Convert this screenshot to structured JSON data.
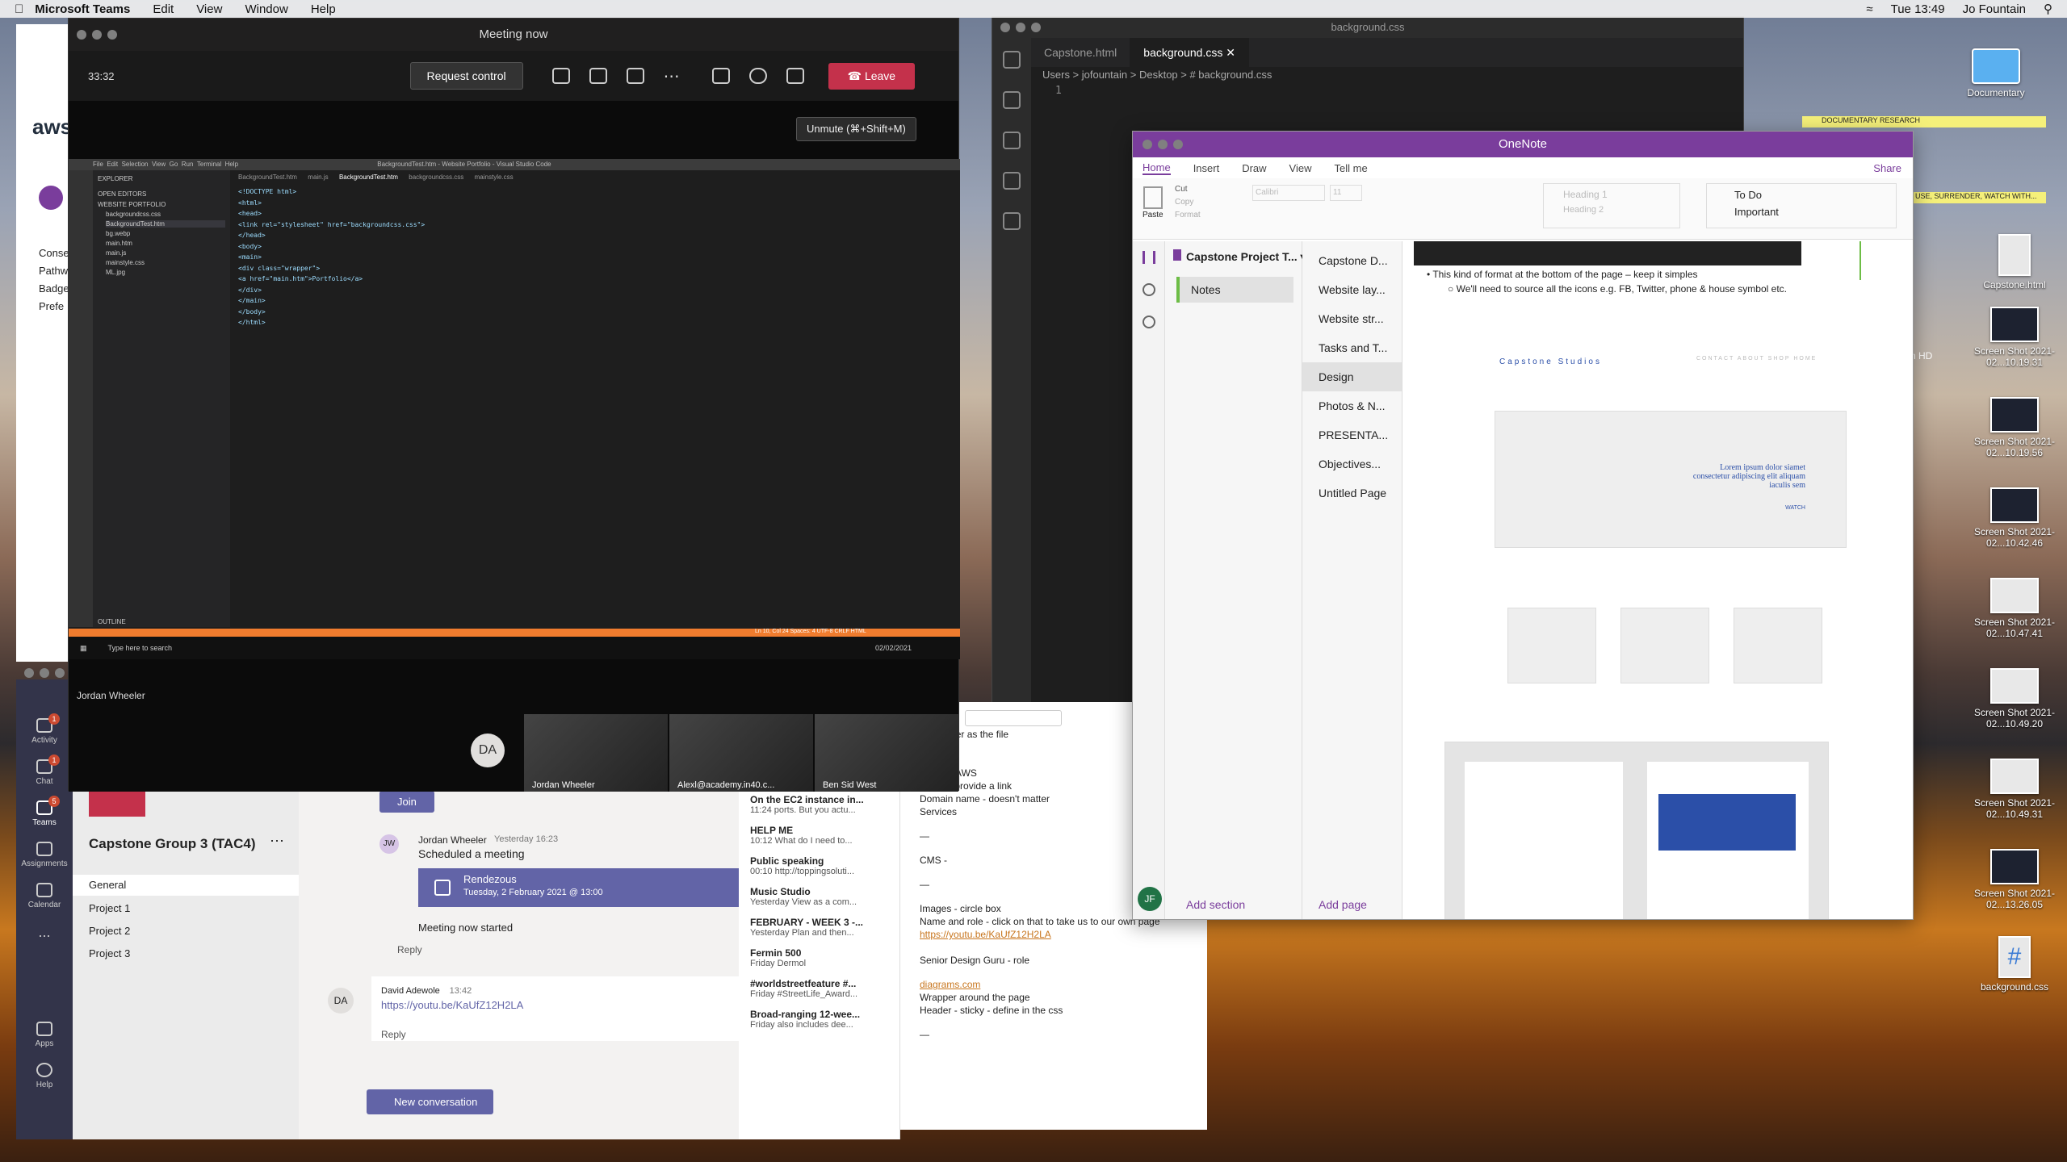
{
  "menubar": {
    "app": "Microsoft Teams",
    "menus": [
      "Edit",
      "View",
      "Window",
      "Help"
    ],
    "clock": "Tue 13:49",
    "user": "Jo Fountain"
  },
  "desktop": {
    "icons": [
      {
        "label": "Documentary"
      },
      {
        "label": "Capstone.html"
      },
      {
        "label": "Screen Shot 2021-02...10.19.31"
      },
      {
        "label": "Screen Shot 2021-02...10.19.56"
      },
      {
        "label": "Screen Shot 2021-02...10.42.46"
      },
      {
        "label": "Screen Shot 2021-02...10.47.41"
      },
      {
        "label": "Screen Shot 2021-02...10.49.20"
      },
      {
        "label": "Screen Shot 2021-02...10.49.31"
      },
      {
        "label": "Screen Shot 2021-02...13.26.05"
      },
      {
        "label": "background.css"
      }
    ],
    "partial_label": "sh HD",
    "sticky": [
      "DOCUMENTARY RESEARCH",
      "USE, SURRENDER, WATCH WITH..."
    ]
  },
  "vscode": {
    "title": "background.css",
    "tabs": [
      "Capstone.html",
      "background.css"
    ],
    "breadcrumb": "Users > jofountain > Desktop > # background.css",
    "line": "1"
  },
  "meeting": {
    "title": "Meeting now",
    "timer": "33:32",
    "request": "Request control",
    "leave": "Leave",
    "tooltip": "Unmute (⌘+Shift+M)",
    "presenter": "Jordan Wheeler",
    "participants": [
      "DA",
      "Jordan Wheeler",
      "Alexl@academy.in40.c...",
      "Ben Sid West"
    ],
    "shared": {
      "window_title": "BackgroundTest.htm - Website Portfolio - Visual Studio Code",
      "menu": [
        "File",
        "Edit",
        "Selection",
        "View",
        "Go",
        "Run",
        "Terminal",
        "Help"
      ],
      "tabs": [
        "BackgroundTest.htm",
        "main.js",
        "BackgroundTest.htm",
        "backgroundcss.css",
        "mainstyle.css"
      ],
      "explorer_title": "EXPLORER",
      "open_editors": "OPEN EDITORS",
      "folder": "WEBSITE PORTFOLIO",
      "files": [
        "backgroundcss.css",
        "BackgroundTest.htm",
        "bg.webp",
        "main.htm",
        "main.js",
        "mainstyle.css",
        "ML.jpg"
      ],
      "outline": "OUTLINE",
      "code": [
        "<!DOCTYPE html>",
        "<html>",
        "<head>",
        "    <link rel=\"stylesheet\" href=\"backgroundcss.css\">",
        "</head>",
        "",
        "<body>",
        "    <main>",
        "        <div class=\"wrapper\">",
        "            <a href=\"main.htm\">Portfolio</a>",
        "        </div>",
        "    </main>",
        "",
        "</body>",
        "",
        "</html>"
      ],
      "status": "Ln 10, Col 24   Spaces: 4   UTF-8   CRLF   HTML",
      "search": "Type here to search",
      "time": "13:49",
      "date": "02/02/2021"
    }
  },
  "teams": {
    "rail": [
      "Activity",
      "Chat",
      "Teams",
      "Assignments",
      "Calendar",
      "...",
      "Apps",
      "Help"
    ],
    "team_name": "Capstone Group 3 (TAC4)",
    "channels": [
      "General",
      "Project 1",
      "Project 2",
      "Project 3"
    ],
    "join": "Join",
    "post1_author": "Jordan Wheeler",
    "post1_time": "Yesterday 16:23",
    "post1_text": "Scheduled a meeting",
    "meeting_card_title": "Rendezous",
    "meeting_card_time": "Tuesday, 2 February 2021 @ 13:00",
    "meeting_started": "Meeting now started",
    "reply": "Reply",
    "post2_author": "David Adewole",
    "post2_time": "13:42",
    "post2_link": "https://youtu.be/KaUfZ12H2LA",
    "new_conversation": "New conversation",
    "avatar_jw": "JW",
    "avatar_da": "DA",
    "notes_list": [
      {
        "title": "On the EC2 instance in...",
        "meta": "11:24  ports. But you actu..."
      },
      {
        "title": "HELP ME",
        "meta": "10:12  What do I need to..."
      },
      {
        "title": "Public speaking",
        "meta": "00:10  http://toppingsoluti..."
      },
      {
        "title": "Music Studio",
        "meta": "Yesterday  View as a com..."
      },
      {
        "title": "FEBRUARY - WEEK 3 -...",
        "meta": "Yesterday  Plan and then..."
      },
      {
        "title": "Fermin 500",
        "meta": "Friday  Dermol"
      },
      {
        "title": "#worldstreetfeature #...",
        "meta": "Friday  #StreetLife_Award..."
      },
      {
        "title": "Broad-ranging 12-wee...",
        "meta": "Friday  also includes dee..."
      }
    ],
    "note_text": [
      "the same older as the file",
      "",
      "Host on AWS",
      "Public - provide a link",
      "Domain name - doesn't matter",
      "Services",
      "",
      "—",
      "",
      "CMS -",
      "",
      "—",
      "",
      "Images - circle box",
      "Name and role - click on that to take us to our own page"
    ],
    "note_link1": "https://youtu.be/KaUfZ12H2LA",
    "note_role": "Senior Design Guru - role",
    "note_link2": "diagrams.com",
    "note_wrapper": "Wrapper around the page",
    "note_header": "Header - sticky - define in the css",
    "note_end": "—",
    "left_strip": [
      "aws",
      "Conse",
      "Pathw",
      "Badge",
      "Prefe"
    ]
  },
  "onenote": {
    "title": "OneNote",
    "tabs": [
      "Home",
      "Insert",
      "Draw",
      "View",
      "Tell me"
    ],
    "share": "Share",
    "paste": "Paste",
    "cut": "Cut",
    "copy": "Copy",
    "format": "Format",
    "font": "Calibri",
    "size": "11",
    "heading1": "Heading 1",
    "heading2": "Heading 2",
    "todo": "To Do",
    "important": "Important",
    "notebook": "Capstone Project T...",
    "section": "Notes",
    "pages": [
      "Capstone D...",
      "Website lay...",
      "Website str...",
      "Tasks and T...",
      "Design",
      "Photos & N...",
      "PRESENTA...",
      "Objectives...",
      "Untitled Page"
    ],
    "bullet1": "This kind of format at the bottom of the page – keep it simples",
    "bullet2": "We'll need to source all the icons e.g. FB, Twitter, phone & house symbol etc.",
    "mock_brand": "Capstone Studios",
    "mock_nav": "CONTACT  ABOUT  SHOP  HOME",
    "mock_lorem": "Lorem ipsum dolor siamet consectetur adipiscing elit aliquam iaculis sem",
    "mock_watch": "WATCH",
    "add_section": "Add section",
    "add_page": "Add page",
    "avatar": "JF"
  }
}
